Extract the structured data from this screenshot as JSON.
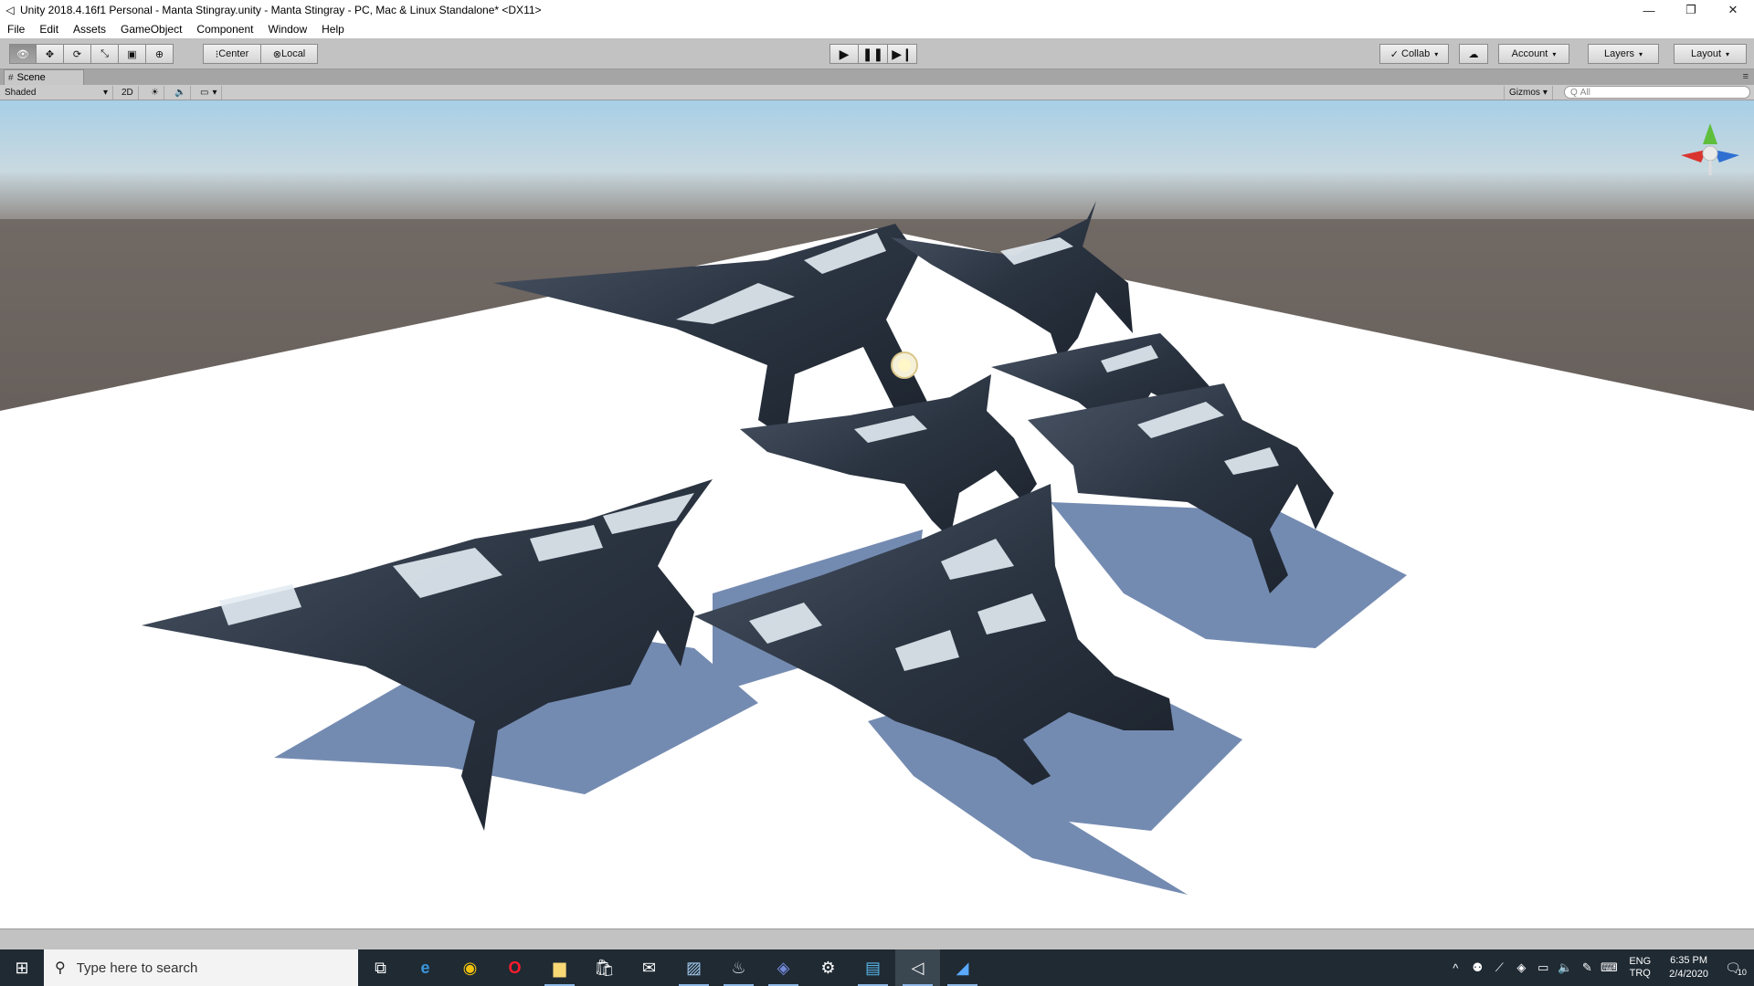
{
  "window": {
    "title": "Unity 2018.4.16f1 Personal - Manta Stingray.unity - Manta Stingray - PC, Mac & Linux Standalone* <DX11>",
    "minimize_glyph": "—",
    "restore_glyph": "❐",
    "close_glyph": "✕"
  },
  "menu": {
    "items": [
      {
        "label": "File"
      },
      {
        "label": "Edit"
      },
      {
        "label": "Assets"
      },
      {
        "label": "GameObject"
      },
      {
        "label": "Component"
      },
      {
        "label": "Window"
      },
      {
        "label": "Help"
      }
    ]
  },
  "toolbar": {
    "tools": [
      "hand-tool-icon",
      "move-tool-icon",
      "rotate-tool-icon",
      "scale-tool-icon",
      "rect-tool-icon",
      "transform-tool-icon"
    ],
    "tool_glyphs": {
      "hand": "👁",
      "move": "✥",
      "rotate": "⟳",
      "scale": "⤡",
      "rect": "▣",
      "transform": "⊕"
    },
    "pivot_label": "Center",
    "handle_label": "Local",
    "pivot_glyph": "⁝",
    "handle_glyph": "⊗",
    "play_glyph": "▶",
    "pause_glyph": "❚❚",
    "step_glyph": "▶❙",
    "collab_label": "Collab",
    "collab_glyph": "✓",
    "cloud_glyph": "☁",
    "account_label": "Account",
    "layers_label": "Layers",
    "layout_label": "Layout",
    "dropdown_glyph": "▾"
  },
  "scene_panel": {
    "tab_label": "Scene",
    "tab_glyph": "#",
    "panel_menu_glyph": "≡",
    "shading_mode": "Shaded",
    "mode_2d": "2D",
    "lighting_glyph": "☀",
    "audio_glyph": "🔈",
    "effects_glyph": "▭",
    "gizmos_label": "Gizmos",
    "search_placeholder": "All",
    "search_glyph": "Q"
  },
  "taskbar": {
    "start_glyph": "⊞",
    "search_placeholder": "Type here to search",
    "search_glyph": "⚲",
    "apps": [
      {
        "name": "task-view-icon",
        "glyph": "⧉",
        "color": "#ffffff"
      },
      {
        "name": "edge-icon",
        "glyph": "e",
        "color": "#3a96dd"
      },
      {
        "name": "chrome-icon",
        "glyph": "◉",
        "color": "#f4c20d"
      },
      {
        "name": "opera-icon",
        "glyph": "O",
        "color": "#ff1b2d"
      },
      {
        "name": "file-explorer-icon",
        "glyph": "▆",
        "color": "#f8d775"
      },
      {
        "name": "store-icon",
        "glyph": "🛍",
        "color": "#ffffff"
      },
      {
        "name": "mail-icon",
        "glyph": "✉",
        "color": "#ffffff"
      },
      {
        "name": "photos-icon",
        "glyph": "▨",
        "color": "#9fc6ea"
      },
      {
        "name": "steam-icon",
        "glyph": "♨",
        "color": "#c7d5e0"
      },
      {
        "name": "discord-icon",
        "glyph": "◈",
        "color": "#7289da"
      },
      {
        "name": "settings-icon",
        "glyph": "⚙",
        "color": "#ffffff"
      },
      {
        "name": "remote-desktop-icon",
        "glyph": "▤",
        "color": "#58b4e6"
      },
      {
        "name": "unity-icon",
        "glyph": "◁",
        "color": "#ffffff"
      },
      {
        "name": "blender-icon",
        "glyph": "◢",
        "color": "#5aa9ff"
      }
    ],
    "tray": {
      "chevron_glyph": "^",
      "icons": [
        "⚉",
        "⟋",
        "◈",
        "▭",
        "🔈",
        "✎",
        "⌨"
      ],
      "lang_line1": "ENG",
      "lang_line2": "TRQ",
      "time": "6:35 PM",
      "date": "2/4/2020",
      "notif_glyph": "🗨",
      "notif_count": "10"
    }
  },
  "colors": {
    "sky_top": "#a9d0e6",
    "horizon": "#7a716c",
    "ground_far": "#69625e",
    "plane": "#ffffff",
    "shadow": "#6f86ad",
    "manta_dark": "#2c3644",
    "manta_light": "#dfe8f0"
  }
}
